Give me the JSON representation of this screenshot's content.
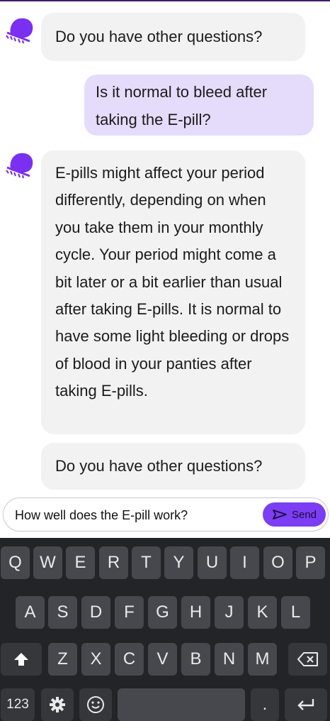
{
  "chat": {
    "messages": [
      {
        "sender": "bot",
        "text": "Do you have other questions?"
      },
      {
        "sender": "user",
        "text": "Is it normal to bleed after taking the E-pill?"
      },
      {
        "sender": "bot",
        "text": "E-pills might affect your period differently, depending on when you take them in your monthly cycle. Your period might come a bit later or a bit earlier than usual after taking E-pills. It is normal to have some light bleeding or drops of blood in your panties after taking E-pills."
      },
      {
        "sender": "bot",
        "text": "Do you have other questions?"
      }
    ],
    "avatar_icon": "mara-bot-logo"
  },
  "composer": {
    "value": "How well does the E-pill work?",
    "send_label": "Send",
    "send_icon": "send-arrow-icon"
  },
  "keyboard": {
    "row1": [
      "Q",
      "W",
      "E",
      "R",
      "T",
      "Y",
      "U",
      "I",
      "O",
      "P"
    ],
    "row2": [
      "A",
      "S",
      "D",
      "F",
      "G",
      "H",
      "J",
      "K",
      "L"
    ],
    "row3": [
      "Z",
      "X",
      "C",
      "V",
      "B",
      "N",
      "M"
    ],
    "numbers_label": "123",
    "period_label": ".",
    "icons": [
      "shift-icon",
      "backspace-icon",
      "settings-icon",
      "emoji-icon",
      "enter-icon"
    ]
  },
  "colors": {
    "accent": "#7b3ef2",
    "user_bubble": "#e5dcfb",
    "bot_bubble": "#f2f2f2",
    "keyboard_bg": "#222427",
    "key_bg": "#46484d"
  }
}
